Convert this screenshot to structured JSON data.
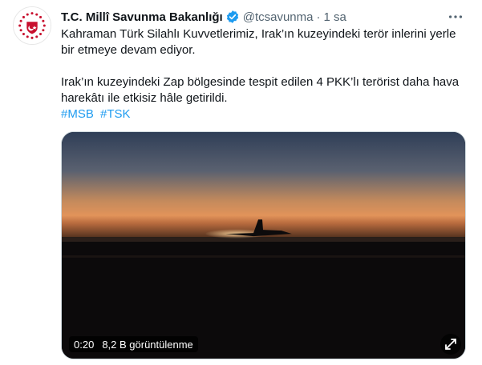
{
  "account": {
    "name": "T.C. Millî Savunma Bakanlığı",
    "handle": "@tcsavunma",
    "separator": "·",
    "time": "1 sa"
  },
  "tweet": {
    "line1a": "Kahraman Türk Silahlı Kuvvetlerimiz, Irak’ın kuzeyindeki terör inlerini yerle",
    "line1b": "bir etmeye devam ediyor.",
    "line2a": "Irak’ın kuzeyindeki Zap bölgesinde tespit edilen 4 PKK’lı terörist daha hava",
    "line2b": "harekâtı ile etkisiz hâle getirildi.",
    "hashtags": [
      "#MSB",
      "#TSK"
    ]
  },
  "video": {
    "duration": "0:20",
    "views": "8,2 B görüntülenme"
  },
  "colors": {
    "link": "#1d9bf0",
    "verified": "#1d9bf0",
    "secondary_text": "#536471",
    "avatar_red": "#c8102e"
  },
  "icons": [
    "verified-badge-icon",
    "more-options-icon",
    "expand-icon",
    "msb-emblem-logo"
  ]
}
